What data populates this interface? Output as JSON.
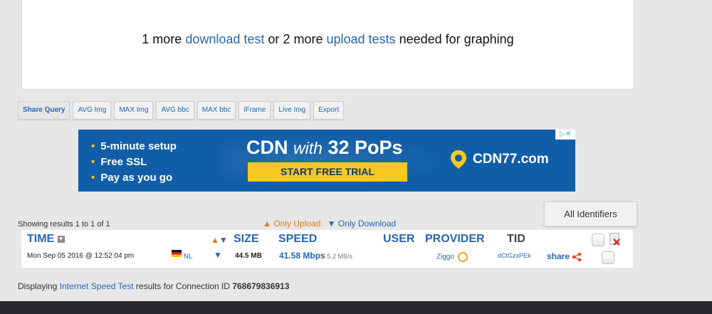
{
  "graph_notice": {
    "prefix": "1 more",
    "download_link": "download test",
    "middle": "or 2 more",
    "upload_link": "upload tests",
    "suffix": "needed for graphing"
  },
  "toolbar": {
    "buttons": [
      "Share Query",
      "AVG Img",
      "MAX Img",
      "AVG bbc",
      "MAX bbc",
      "iFrame",
      "Live Img",
      "Export"
    ]
  },
  "ad": {
    "bullets": [
      "5-minute setup",
      "Free SSL",
      "Pay as you go"
    ],
    "headline_cdn": "CDN",
    "headline_with": "with",
    "headline_pops": "32 PoPs",
    "cta": "START FREE TRIAL",
    "brand": "CDN77.com",
    "brand_color": "#f7c81f",
    "background": "#115ea8"
  },
  "results": {
    "showing": "Showing results 1 to 1 of 1",
    "only_upload": "Only Upload",
    "only_download": "Only Download",
    "all_identifiers": "All Identifiers",
    "columns": {
      "time": "TIME",
      "size": "SIZE",
      "speed": "SPEED",
      "user": "USER",
      "provider": "PROVIDER",
      "tid": "TID"
    },
    "row": {
      "time": "Mon Sep 05 2016 @ 12:52:04 pm",
      "country": "NL",
      "size": "44.5 MB",
      "speed": "41.58 Mbps",
      "speed_alt": "5.2 MB/s",
      "provider": "Ziggo",
      "tid": "dCtGzxPEk",
      "share": "share"
    }
  },
  "footer": {
    "prefix": "Displaying",
    "link": "Internet Speed Test",
    "middle": "results for Connection ID",
    "connection_id": "768679836913"
  }
}
